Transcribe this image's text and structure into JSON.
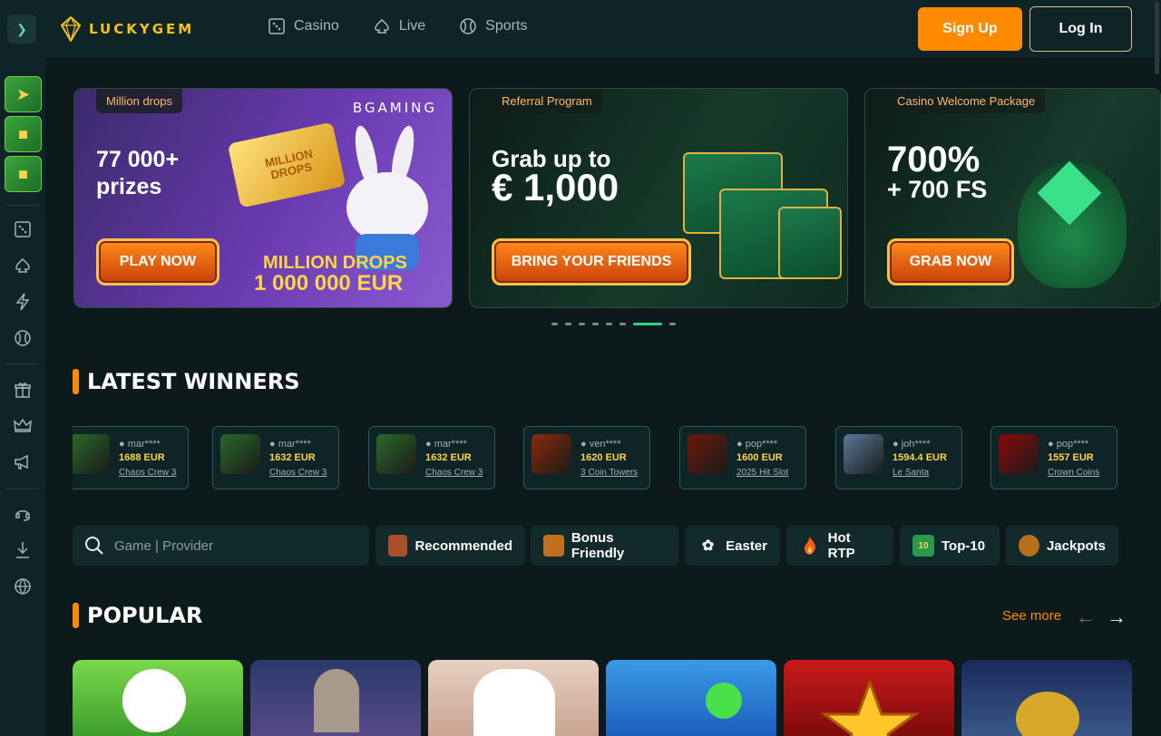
{
  "header": {
    "logo_text": "LUCKYGEM",
    "nav": [
      {
        "label": "Casino",
        "icon": "dice-icon"
      },
      {
        "label": "Live",
        "icon": "spade-icon"
      },
      {
        "label": "Sports",
        "icon": "tennis-ball-icon"
      }
    ],
    "signup_label": "Sign Up",
    "login_label": "Log In"
  },
  "sidebar": {
    "thumbs": [
      "game-thumb-1",
      "game-thumb-2",
      "game-thumb-3"
    ],
    "icons": [
      "dice-icon",
      "spade-icon",
      "lightning-icon",
      "tennis-ball-icon",
      "gift-icon",
      "crown-icon",
      "megaphone-icon",
      "headset-icon",
      "download-icon",
      "globe-icon"
    ]
  },
  "banners": [
    {
      "tag": "Million drops",
      "headline_1": "77 000+",
      "headline_2": "prizes",
      "button": "PLAY NOW",
      "brand": "BGAMING",
      "art_text_1": "MILLION DROPS",
      "art_text_2": "1 000 000 EUR",
      "bar_text": "MILLION DROPS"
    },
    {
      "tag": "Referral Program",
      "headline_1": "Grab up to",
      "headline_2": "€ 1,000",
      "button": "BRING YOUR FRIENDS"
    },
    {
      "tag": "Casino Welcome Package",
      "headline_1": "700%",
      "headline_2": "+ 700 FS",
      "button": "GRAB NOW"
    }
  ],
  "latest_winners": {
    "title": "LATEST WINNERS",
    "items": [
      {
        "user": "mar****",
        "amount": "1688 EUR",
        "game": "Chaos Crew 3",
        "color": "#2a6a2a"
      },
      {
        "user": "mar****",
        "amount": "1632 EUR",
        "game": "Chaos Crew 3",
        "color": "#2a6a2a"
      },
      {
        "user": "mar****",
        "amount": "1632 EUR",
        "game": "Chaos Crew 3",
        "color": "#2a6a2a"
      },
      {
        "user": "ven****",
        "amount": "1620 EUR",
        "game": "3 Coin Towers",
        "color": "#8a2a0a"
      },
      {
        "user": "pop****",
        "amount": "1600 EUR",
        "game": "2025 Hit Slot",
        "color": "#6a1a0a"
      },
      {
        "user": "joh****",
        "amount": "1594.4 EUR",
        "game": "Le Santa",
        "color": "#5a7a9a"
      },
      {
        "user": "pop****",
        "amount": "1557 EUR",
        "game": "Crown Coins",
        "color": "#8a0a0a"
      }
    ]
  },
  "search": {
    "placeholder": "Game | Provider"
  },
  "categories": [
    {
      "label": "Recommended",
      "icon": "treasure-chest-icon"
    },
    {
      "label": "Bonus Friendly",
      "icon": "chest-icon"
    },
    {
      "label": "Easter",
      "icon": "bunny-icon"
    },
    {
      "label": "Hot RTP",
      "icon": "fire-icon"
    },
    {
      "label": "Top-10",
      "icon": "top-badge-icon"
    },
    {
      "label": "Jackpots",
      "icon": "money-bag-icon"
    }
  ],
  "popular": {
    "title": "POPULAR",
    "see_more": "See more"
  },
  "colors": {
    "accent": "#ff8a00",
    "active_dot": "#2ecf8a",
    "bg": "#0d1a1c",
    "panel": "#0f2426"
  }
}
